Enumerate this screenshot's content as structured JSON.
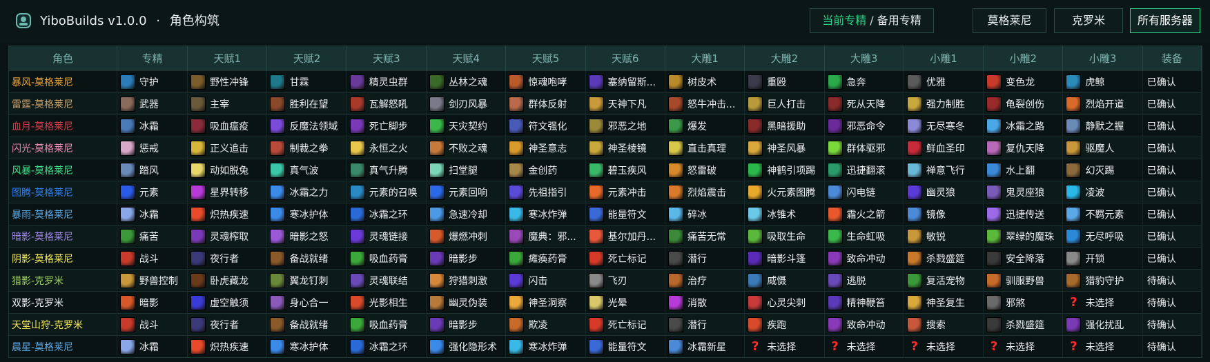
{
  "header": {
    "app_title": "YiboBuilds v1.0.0",
    "dot": "·",
    "section_title": "角色构筑",
    "spec_active": "当前专精",
    "spec_sep": "/",
    "spec_inactive": "备用专精",
    "realms": [
      "莫格莱尼",
      "克罗米",
      "所有服务器"
    ],
    "selected_realm": "所有服务器"
  },
  "colors": {
    "accent": "#2fd28a",
    "unknown_icon": "#ff2a2a"
  },
  "table": {
    "columns": [
      "角色",
      "专精",
      "天赋1",
      "天赋2",
      "天赋3",
      "天赋4",
      "天赋5",
      "天赋6",
      "大雕1",
      "大雕2",
      "大雕3",
      "小雕1",
      "小雕2",
      "小雕3",
      "装备"
    ],
    "rows": [
      {
        "name": "暴风-莫格莱尼",
        "color": "#e8a33a",
        "cells": [
          "守护",
          "野性冲锋",
          "甘霖",
          "精灵虫群",
          "丛林之魂",
          "惊魂咆哮",
          "塞纳留斯...",
          "树皮术",
          "重殴",
          "急奔",
          "优雅",
          "变色龙",
          "虎鲸"
        ],
        "status": "已确认"
      },
      {
        "name": "雷霆-莫格莱尼",
        "color": "#c8a06a",
        "cells": [
          "武器",
          "主宰",
          "胜利在望",
          "瓦解怒吼",
          "剑刃风暴",
          "群体反射",
          "天神下凡",
          "怒牛冲击...",
          "巨人打击",
          "死从天降",
          "强力制胜",
          "龟裂创伤",
          "烈焰开道"
        ],
        "status": "已确认"
      },
      {
        "name": "血月-莫格莱尼",
        "color": "#d93b4a",
        "cells": [
          "冰霜",
          "吸血瘟疫",
          "反魔法领域",
          "死亡脚步",
          "天灾契约",
          "符文强化",
          "邪恶之地",
          "爆发",
          "黑暗援助",
          "邪恶命令",
          "无尽寒冬",
          "冰霜之路",
          "静默之握"
        ],
        "status": "已确认"
      },
      {
        "name": "闪光-莫格莱尼",
        "color": "#f08ab6",
        "cells": [
          "惩戒",
          "正义追击",
          "制裁之拳",
          "永恒之火",
          "不败之魂",
          "神圣意志",
          "神圣棱镜",
          "直击真理",
          "神圣风暴",
          "群体驱邪",
          "鲜血圣印",
          "复仇天降",
          "驱魔人"
        ],
        "status": "已确认"
      },
      {
        "name": "风暴-莫格莱尼",
        "color": "#3ee08a",
        "cells": [
          "踏风",
          "动如脱兔",
          "真气波",
          "真气升腾",
          "扫堂腿",
          "金创药",
          "碧玉疾风",
          "怒雷破",
          "神鹤引项踢",
          "迅捷翻滚",
          "禅意飞行",
          "水上翻",
          "幻灭踢"
        ],
        "status": "已确认"
      },
      {
        "name": "图腾-莫格莱尼",
        "color": "#2f7df0",
        "cells": [
          "元素",
          "星界转移",
          "冰霜之力",
          "元素的召唤",
          "元素回响",
          "先祖指引",
          "元素冲击",
          "烈焰震击",
          "火元素图腾",
          "闪电链",
          "幽灵狼",
          "鬼灵座狼",
          "凌波"
        ],
        "status": "已确认"
      },
      {
        "name": "暴雨-莫格莱尼",
        "color": "#5aa8e6",
        "cells": [
          "冰霜",
          "炽热疾速",
          "寒冰护体",
          "冰霜之环",
          "急速冷却",
          "寒冰炸弹",
          "能量符文",
          "碎冰",
          "冰锥术",
          "霜火之箭",
          "镜像",
          "迅捷传送",
          "不羁元素"
        ],
        "status": "已确认"
      },
      {
        "name": "暗影-莫格莱尼",
        "color": "#9f86e6",
        "cells": [
          "痛苦",
          "灵魂榨取",
          "暗影之怒",
          "灵魂链接",
          "爆燃冲刺",
          "魔典：邪...",
          "基尔加丹...",
          "痛苦无常",
          "吸取生命",
          "生命虹吸",
          "敏锐",
          "翠绿的魔珠",
          "无尽呼吸"
        ],
        "status": "已确认"
      },
      {
        "name": "阴影-莫格莱尼",
        "color": "#f3e85a",
        "cells": [
          "战斗",
          "夜行者",
          "备战就绪",
          "吸血药膏",
          "暗影步",
          "瘫痪药膏",
          "死亡标记",
          "潜行",
          "暗影斗篷",
          "致命冲动",
          "杀戮盛筵",
          "安全降落",
          "开锁"
        ],
        "status": "已确认"
      },
      {
        "name": "猎影-克罗米",
        "color": "#9fce62",
        "cells": [
          "野兽控制",
          "卧虎藏龙",
          "翼龙钉刺",
          "灵魂联结",
          "狩猎刺激",
          "闪击",
          "飞刃",
          "治疗",
          "威慑",
          "逃脱",
          "复活宠物",
          "驯服野兽",
          "猎豹守护"
        ],
        "status": "待确认"
      },
      {
        "name": "双影-克罗米",
        "color": "#eef0f0",
        "cells": [
          "暗影",
          "虚空触须",
          "身心合一",
          "光影相生",
          "幽灵伪装",
          "神圣洞察",
          "光晕",
          "消散",
          "心灵尖刺",
          "精神鞭笞",
          "神圣复生",
          "邪煞",
          "未选择"
        ],
        "status": "待确认"
      },
      {
        "name": "天堂山狩-克罗米",
        "color": "#f3e85a",
        "cells": [
          "战斗",
          "夜行者",
          "备战就绪",
          "吸血药膏",
          "暗影步",
          "欺凌",
          "死亡标记",
          "潜行",
          "疾跑",
          "致命冲动",
          "搜索",
          "杀戮盛筵",
          "强化扰乱"
        ],
        "status": "待确认"
      },
      {
        "name": "晨星-莫格莱尼",
        "color": "#5aa8e6",
        "cells": [
          "冰霜",
          "炽热疾速",
          "寒冰护体",
          "冰霜之环",
          "强化隐形术",
          "寒冰炸弹",
          "能量符文",
          "冰霜新星",
          "未选择",
          "未选择",
          "未选择",
          "未选择",
          "未选择"
        ],
        "status": "待确认"
      }
    ],
    "icon_colors": [
      [
        "#2a7db8",
        "#7a5c2a",
        "#1e7a8a",
        "#6a3a9a",
        "#3a6a2a",
        "#b85a2a",
        "#5a3ab8",
        "#b88a2a",
        "#3a3a4a",
        "#2aa84a",
        "#5a5a5a",
        "#c83a2a",
        "#2a8ab8"
      ],
      [
        "#8a6a5a",
        "#6a5a3a",
        "#8a4a2a",
        "#a83a2a",
        "#7a7a8a",
        "#b86a4a",
        "#c89a3a",
        "#a84a2a",
        "#b89a3a",
        "#8a2a2a",
        "#c8a83a",
        "#9a2a2a",
        "#d86a2a"
      ],
      [
        "#4a7ab8",
        "#8a2a3a",
        "#7a4ad8",
        "#7a3ab8",
        "#3ab84a",
        "#4a5ab8",
        "#9a8a3a",
        "#3a9a4a",
        "#8a2a2a",
        "#6a2a9a",
        "#8a8ad8",
        "#4aa8e8",
        "#6a8ab8"
      ],
      [
        "#d8a8c8",
        "#d8b83a",
        "#b84a3a",
        "#e8c84a",
        "#c87a3a",
        "#d89a2a",
        "#c8a83a",
        "#d8c84a",
        "#d8a83a",
        "#7ad83a",
        "#c82a3a",
        "#b86ab8",
        "#c8983a"
      ],
      [
        "#6a8ab8",
        "#e8d86a",
        "#3ac8a8",
        "#3a8a6a",
        "#7ad8b8",
        "#a8884a",
        "#3ab86a",
        "#d88a2a",
        "#2ab84a",
        "#2a9a6a",
        "#6ab8d8",
        "#3a8ad8",
        "#8a6a3a"
      ],
      [
        "#2a5ae8",
        "#b83ad8",
        "#3a8ae8",
        "#2a8ac8",
        "#2a6ae8",
        "#5a4ad8",
        "#e86a2a",
        "#d87a2a",
        "#e8a82a",
        "#4a8ad8",
        "#5a3ad8",
        "#7a5ab8",
        "#2ab8e8"
      ],
      [
        "#8aa8e8",
        "#e84a2a",
        "#3a8ae8",
        "#2a6ad8",
        "#4a9ae8",
        "#3ab8e8",
        "#3a6ad8",
        "#5ab8e8",
        "#6ac8e8",
        "#e8582a",
        "#4a8ad8",
        "#9a6ae8",
        "#5aa8e8"
      ],
      [
        "#3a9a3a",
        "#7a3ab8",
        "#9a5ad8",
        "#6a3ad8",
        "#d85a2a",
        "#9a4ab8",
        "#e8583a",
        "#3a8a3a",
        "#5ab83a",
        "#3ab84a",
        "#c8983a",
        "#5ab83a",
        "#2a8ad8"
      ],
      [
        "#c83a2a",
        "#3a3a7a",
        "#8a5a2a",
        "#3aa83a",
        "#6a3ab8",
        "#3aa83a",
        "#d83a2a",
        "#4a4a4a",
        "#5a2ab8",
        "#8a3ab8",
        "#c87a2a",
        "#3a3a3a",
        "#8a8a8a"
      ],
      [
        "#c8983a",
        "#6a3a1a",
        "#6a8a3a",
        "#6a4ab8",
        "#d8883a",
        "#5a3ad8",
        "#8a8a8a",
        "#b8682a",
        "#3a7ab8",
        "#6a4ab8",
        "#3a9a3a",
        "#c86a2a",
        "#a86a2a"
      ],
      [
        "#d8582a",
        "#3a3ad8",
        "#8a5ab8",
        "#d84a2a",
        "#b87a3a",
        "#e8a83a",
        "#d8c86a",
        "#b83ad8",
        "#c83a3a",
        "#5a3ab8",
        "#d8a83a",
        "#6a6a6a",
        "#ff2a2a"
      ],
      [
        "#c83a2a",
        "#3a3a7a",
        "#8a5a2a",
        "#3aa83a",
        "#6a3ab8",
        "#c86a2a",
        "#d83a2a",
        "#4a4a4a",
        "#d84a2a",
        "#8a3ab8",
        "#c8583a",
        "#3a3a3a",
        "#7a3ab8"
      ],
      [
        "#8aa8e8",
        "#e84a2a",
        "#3a8ae8",
        "#2a6ad8",
        "#3a8ae8",
        "#3ab8e8",
        "#3a6ad8",
        "#4a8ad8",
        "#ff2a2a",
        "#ff2a2a",
        "#ff2a2a",
        "#ff2a2a",
        "#ff2a2a"
      ]
    ]
  }
}
